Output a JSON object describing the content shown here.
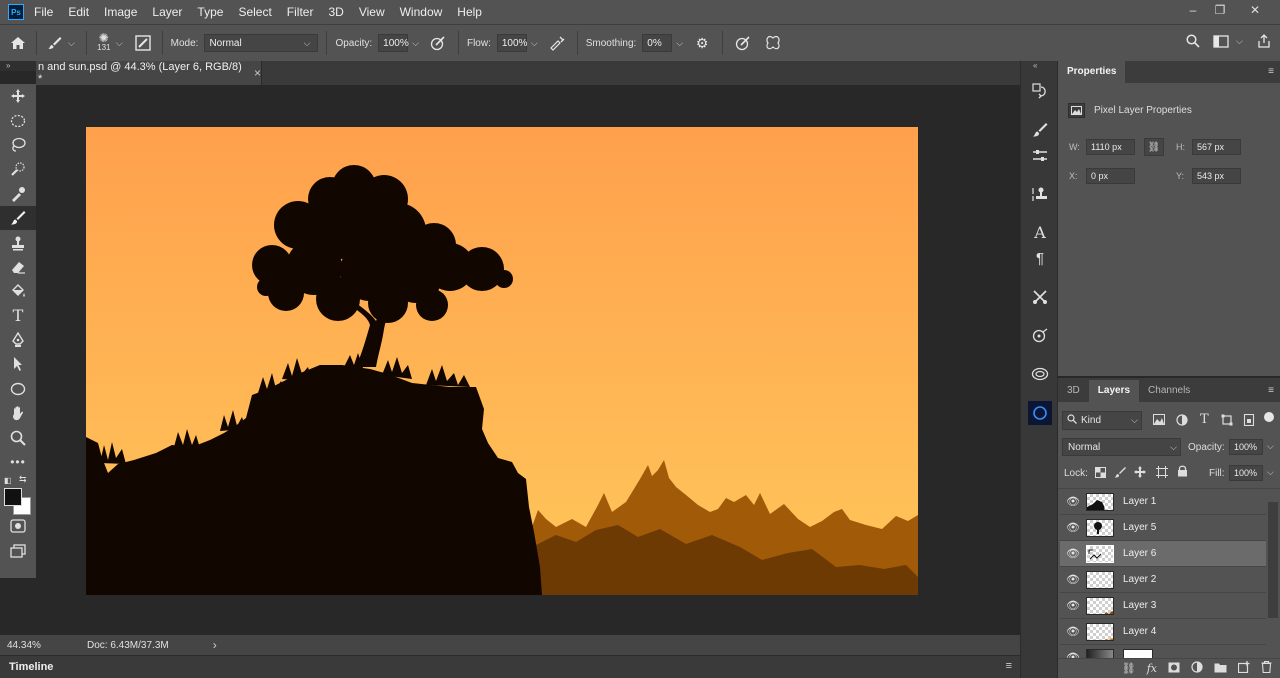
{
  "app": {
    "logo": "Ps"
  },
  "menu": [
    "File",
    "Edit",
    "Image",
    "Layer",
    "Type",
    "Select",
    "Filter",
    "3D",
    "View",
    "Window",
    "Help"
  ],
  "window_controls": {
    "minimize": "–",
    "restore": "❐",
    "close": "✕"
  },
  "options_bar": {
    "brush_size": "131",
    "mode_label": "Mode:",
    "mode_value": "Normal",
    "opacity_label": "Opacity:",
    "opacity_value": "100%",
    "flow_label": "Flow:",
    "flow_value": "100%",
    "smoothing_label": "Smoothing:",
    "smoothing_value": "0%"
  },
  "document": {
    "tab_title": "n and sun.psd @ 44.3% (Layer 6, RGB/8) *",
    "close_glyph": "×"
  },
  "status": {
    "zoom": "44.34%",
    "doc_info": "Doc: 6.43M/37.3M",
    "arrow": "›"
  },
  "timeline": {
    "label": "Timeline"
  },
  "properties": {
    "tab": "Properties",
    "header": "Pixel Layer Properties",
    "w_label": "W:",
    "w_value": "1110 px",
    "h_label": "H:",
    "h_value": "567 px",
    "x_label": "X:",
    "x_value": "0 px",
    "y_label": "Y:",
    "y_value": "543 px"
  },
  "layers_panel": {
    "tabs": [
      "3D",
      "Layers",
      "Channels"
    ],
    "active_tab": "Layers",
    "filter_kind": "Kind",
    "blend_mode": "Normal",
    "opacity_label": "Opacity:",
    "opacity_value": "100%",
    "lock_label": "Lock:",
    "fill_label": "Fill:",
    "fill_value": "100%",
    "layers": [
      {
        "name": "Layer 1",
        "selected": false
      },
      {
        "name": "Layer 5",
        "selected": false
      },
      {
        "name": "Layer 6",
        "selected": true
      },
      {
        "name": "Layer 2",
        "selected": false
      },
      {
        "name": "Layer 3",
        "selected": false
      },
      {
        "name": "Layer 4",
        "selected": false
      }
    ]
  },
  "colors": {
    "sky_top": "#ffa04d",
    "sky_bottom": "#ffc75a",
    "silhouette": "#120600",
    "mountain_back": "#a05a08",
    "mountain_front": "#6e3a03",
    "foreground": "#111111",
    "background": "#ffffff"
  },
  "icons": {
    "tools": [
      "move-icon",
      "marquee-icon",
      "lasso-icon",
      "quick-select-icon",
      "eyedropper-icon",
      "brush-icon",
      "stamp-icon",
      "eraser-icon",
      "paint-bucket-icon",
      "type-icon",
      "pen-icon",
      "path-select-icon",
      "ellipse-icon",
      "hand-icon",
      "zoom-icon",
      "more-icon"
    ]
  }
}
